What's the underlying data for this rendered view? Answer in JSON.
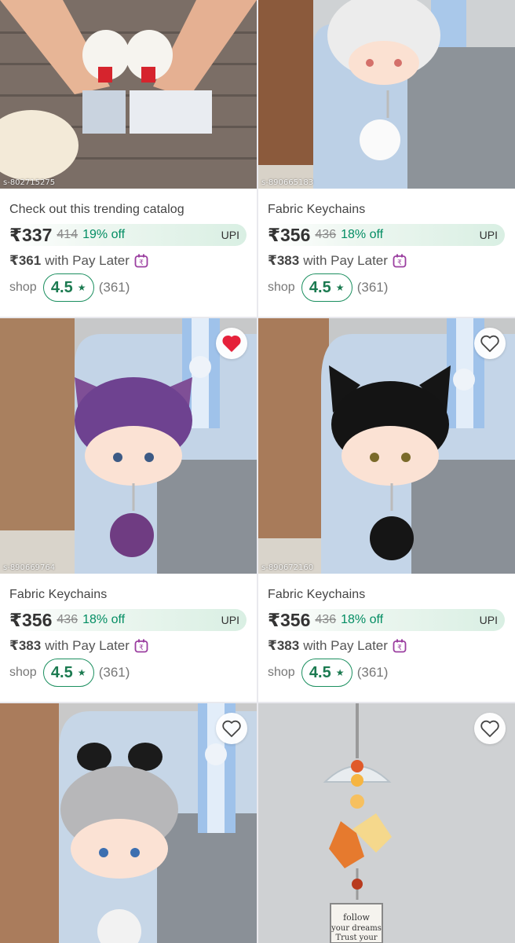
{
  "products": [
    {
      "sku": "s-802715275",
      "title": "Check out this trending catalog",
      "price": "₹337",
      "mrp": "414",
      "discount": "19% off",
      "upi": "UPI",
      "pay_later_amount": "₹361",
      "pay_later_text": "with Pay Later",
      "shop_label": "shop",
      "rating": "4.5",
      "rating_count": "(361)",
      "wishlisted": false
    },
    {
      "sku": "s-890665183",
      "title": "Fabric  Keychains",
      "price": "₹356",
      "mrp": "436",
      "discount": "18% off",
      "upi": "UPI",
      "pay_later_amount": "₹383",
      "pay_later_text": "with Pay Later",
      "shop_label": "shop",
      "rating": "4.5",
      "rating_count": "(361)",
      "wishlisted": false
    },
    {
      "sku": "s-890669764",
      "title": "Fabric  Keychains",
      "price": "₹356",
      "mrp": "436",
      "discount": "18% off",
      "upi": "UPI",
      "pay_later_amount": "₹383",
      "pay_later_text": "with Pay Later",
      "shop_label": "shop",
      "rating": "4.5",
      "rating_count": "(361)",
      "wishlisted": true
    },
    {
      "sku": "s-890672160",
      "title": "Fabric  Keychains",
      "price": "₹356",
      "mrp": "436",
      "discount": "18% off",
      "upi": "UPI",
      "pay_later_amount": "₹383",
      "pay_later_text": "with Pay Later",
      "shop_label": "shop",
      "rating": "4.5",
      "rating_count": "(361)",
      "wishlisted": false
    },
    {
      "wishlisted": false
    },
    {
      "wishlisted": false,
      "charm_text": "follow your dreams Trust your"
    }
  ],
  "colors": {
    "accent_green": "#038d63",
    "rating_green": "#1b7a50",
    "wishlist_red": "#e5213a",
    "pay_later_purple": "#9b3fa0"
  },
  "icons": {
    "wishlist": "heart-icon",
    "rating": "star-icon",
    "pay_later": "calendar-icon"
  }
}
